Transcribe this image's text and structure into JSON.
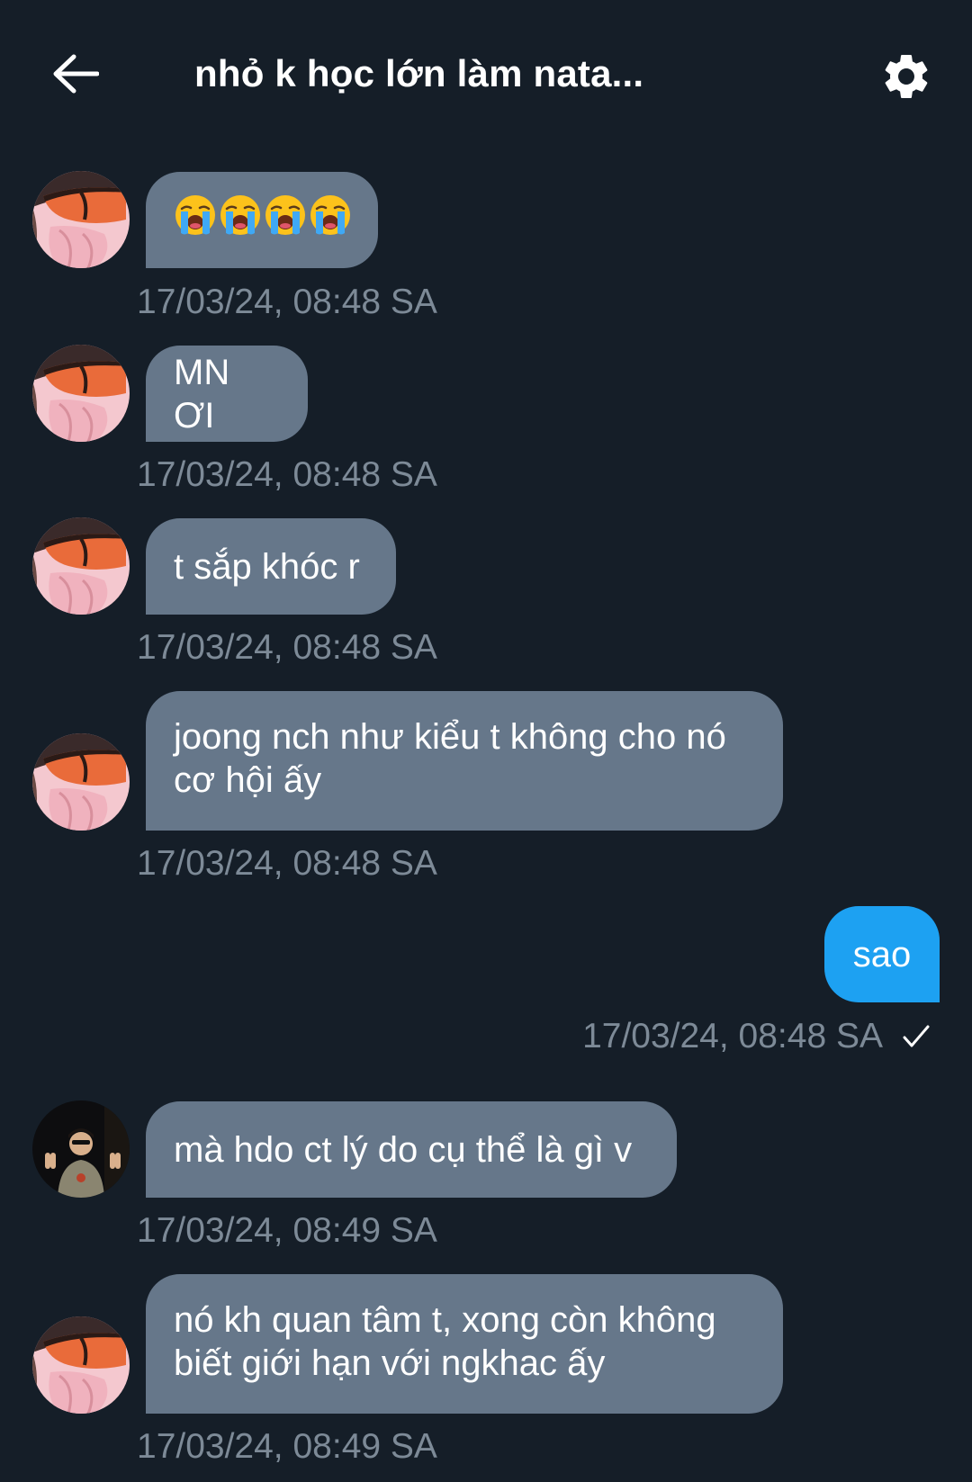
{
  "header": {
    "back_icon": "arrow-left-icon",
    "title": "nhỏ k học lớn làm nata...",
    "settings_icon": "gear-icon"
  },
  "messages": [
    {
      "direction": "in",
      "avatar": "avatar-sunglasses",
      "text": "",
      "emoji": [
        "loudly-crying-face",
        "loudly-crying-face",
        "loudly-crying-face",
        "loudly-crying-face"
      ],
      "timestamp": "17/03/24, 08:48 SA"
    },
    {
      "direction": "in",
      "avatar": "avatar-sunglasses",
      "text": "MN ƠI",
      "timestamp": "17/03/24, 08:48 SA"
    },
    {
      "direction": "in",
      "avatar": "avatar-sunglasses",
      "text": "t sắp khóc r",
      "timestamp": "17/03/24, 08:48 SA"
    },
    {
      "direction": "in",
      "avatar": "avatar-sunglasses",
      "lines": [
        "joong nch như kiểu t không cho nó",
        "cơ hội ấy"
      ],
      "timestamp": "17/03/24, 08:48 SA"
    },
    {
      "direction": "out",
      "text": "sao",
      "timestamp": "17/03/24, 08:48 SA",
      "status_icon": "check-icon"
    },
    {
      "direction": "in",
      "avatar": "avatar-peace-sign",
      "text": "mà hdo ct lý do cụ thể là gì v",
      "timestamp": "17/03/24, 08:49 SA"
    },
    {
      "direction": "in",
      "avatar": "avatar-sunglasses",
      "lines": [
        "nó kh quan tâm t, xong còn không",
        "biết giới hạn với ngkhac ấy"
      ],
      "timestamp": "17/03/24, 08:49 SA"
    }
  ],
  "colors": {
    "background": "#151e28",
    "incoming_bubble": "#66778a",
    "outgoing_bubble": "#1da1f2",
    "timestamp": "#7d8a97"
  }
}
